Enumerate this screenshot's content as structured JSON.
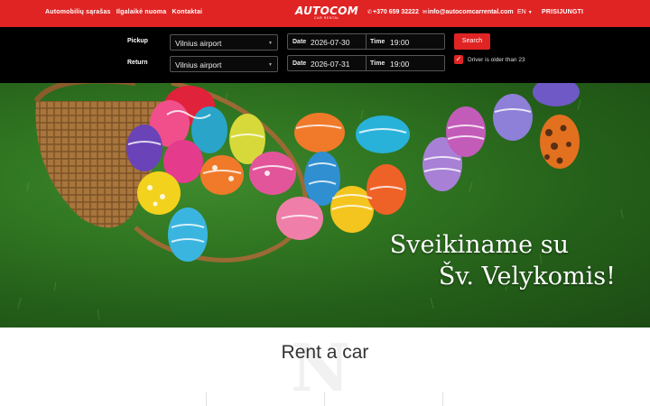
{
  "nav": {
    "links": [
      "Automobilių sąrašas",
      "Ilgalaikė nuoma",
      "Kontaktai"
    ],
    "logo_text": "AUTOCOM",
    "logo_tagline": "CAR RENTAL",
    "phone": "+370 659 32222",
    "email": "info@autocomcarrental.com",
    "language": "EN",
    "login": "PRISIJUNGTI"
  },
  "booking": {
    "pickup_label": "Pickup",
    "return_label": "Return",
    "pickup_location": "Vilnius airport",
    "return_location": "Vilnius airport",
    "date_label": "Date",
    "time_label": "Time",
    "pickup_date": "2026-07-30",
    "pickup_time": "19:00",
    "return_date": "2026-07-31",
    "return_time": "19:00",
    "search_label": "Search",
    "driver_age_label": "Driver is older than 23",
    "driver_age_checked": true
  },
  "hero": {
    "line1": "Sveikiname su",
    "line2": "Šv. Velykomis!"
  },
  "section": {
    "title": "Rent a car",
    "watermark": "N"
  },
  "colors": {
    "accent": "#e02424",
    "booking_bg": "#000000",
    "grass": "#2f7421"
  },
  "icons": {
    "phone": "phone-icon",
    "email": "email-icon",
    "dropdown": "chevron-down-icon",
    "check": "check-icon"
  }
}
